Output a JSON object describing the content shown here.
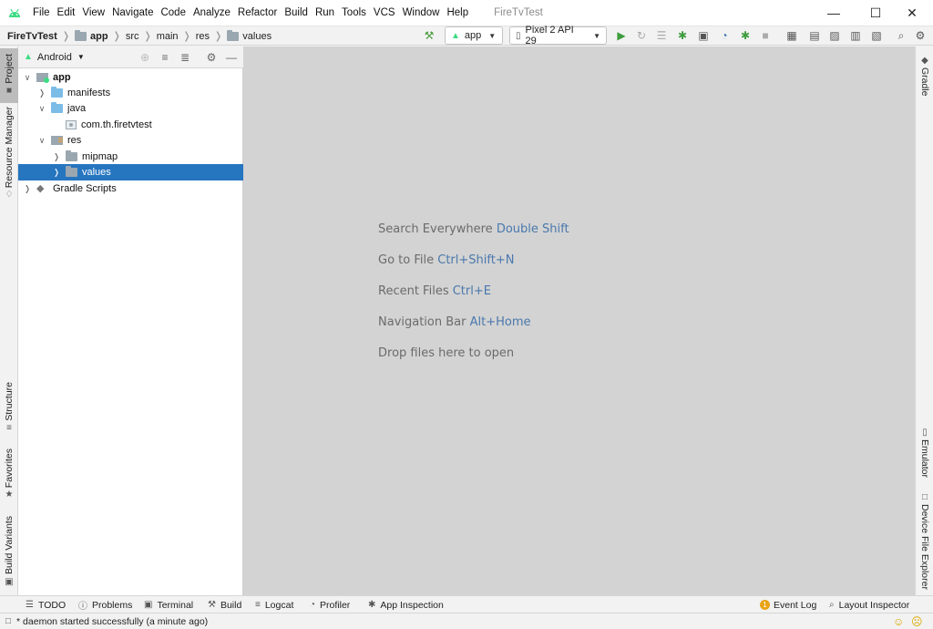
{
  "menu": [
    "File",
    "Edit",
    "View",
    "Navigate",
    "Code",
    "Analyze",
    "Refactor",
    "Build",
    "Run",
    "Tools",
    "VCS",
    "Window",
    "Help"
  ],
  "window_title": "FireTvTest",
  "breadcrumb": [
    "FireTvTest",
    "app",
    "src",
    "main",
    "res",
    "values"
  ],
  "run_config": "app",
  "device": "Pixel 2 API 29",
  "project_view": "Android",
  "tree": [
    {
      "label": "app",
      "expanded": true
    },
    {
      "label": "manifests",
      "expanded": false
    },
    {
      "label": "java",
      "expanded": true
    },
    {
      "label": "com.th.firetvtest"
    },
    {
      "label": "res",
      "expanded": true
    },
    {
      "label": "mipmap",
      "expanded": false
    },
    {
      "label": "values",
      "expanded": false,
      "selected": true
    },
    {
      "label": "Gradle Scripts",
      "expanded": false
    }
  ],
  "left_tabs": [
    "Project",
    "Resource Manager",
    "Structure",
    "Favorites",
    "Build Variants"
  ],
  "right_tabs": [
    "Gradle",
    "Emulator",
    "Device File Explorer"
  ],
  "editor_hints": [
    {
      "text": "Search Everywhere",
      "key": "Double Shift"
    },
    {
      "text": "Go to File",
      "key": "Ctrl+Shift+N"
    },
    {
      "text": "Recent Files",
      "key": "Ctrl+E"
    },
    {
      "text": "Navigation Bar",
      "key": "Alt+Home"
    },
    {
      "text": "Drop files here to open",
      "key": ""
    }
  ],
  "bottom_tabs": [
    "TODO",
    "Problems",
    "Terminal",
    "Build",
    "Logcat",
    "Profiler",
    "App Inspection"
  ],
  "bottom_right_tabs": [
    "Event Log",
    "Layout Inspector"
  ],
  "event_log_count": "1",
  "status_text": "* daemon started successfully (a minute ago)",
  "colors": {
    "accent": "#2675bf",
    "android_green": "#3ddc84",
    "hint_key": "#4a78ad"
  }
}
